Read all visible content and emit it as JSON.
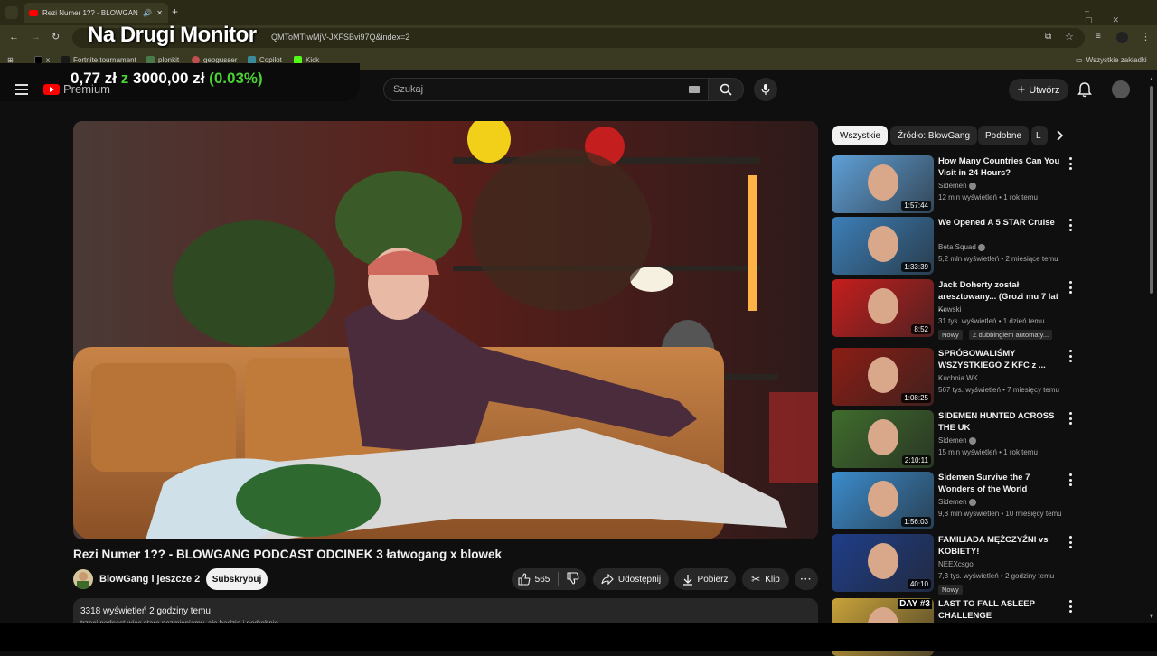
{
  "browser": {
    "tab_title": "Rezi Numer 1?? - BLOWGANG",
    "url": "QMToMTIwMjV-JXFSBvi97Q&index=2",
    "bookmarks": [
      "x",
      "Fortnite tournament",
      "plonkit",
      "geogusser",
      "Copilot",
      "Kick"
    ],
    "bookmarks_right": "Wszystkie zakładki"
  },
  "overlay": {
    "title": "Na Drugi Monitor",
    "donation_current": "0,77 zł",
    "donation_sep": "z",
    "donation_goal": "3000,00 zł",
    "donation_percent": "(0.03%)"
  },
  "header": {
    "logo_text": "Premium",
    "search_placeholder": "Szukaj",
    "create_label": "Utwórz"
  },
  "video": {
    "title": "Rezi Numer 1?? - BLOWGANG PODCAST ODCINEK 3 łatwogang x blowek",
    "channel": "BlowGang i jeszcze 2",
    "subscribe": "Subskrybuj",
    "likes": "565",
    "share": "Udostępnij",
    "download": "Pobierz",
    "clip": "Klip",
    "views_line": "3318 wyświetleń  2 godziny temu",
    "desc_line": "trzeci podcast więc stare pozmieniamy, ale będzie i podrobnie"
  },
  "chips": [
    "Wszystkie",
    "Źródło: BlowGang",
    "Podobne",
    "L"
  ],
  "recommendations": [
    {
      "title": "How Many Countries Can You Visit in 24 Hours?",
      "channel": "Sidemen",
      "verified": true,
      "meta": "12 mln wyświetleń • 1 rok temu",
      "duration": "1:57:44",
      "color": "#5fa0d8"
    },
    {
      "title": "We Opened A 5 STAR Cruise",
      "channel": "Beta Squad",
      "verified": true,
      "meta": "5,2 mln wyświetleń • 2 miesiące temu",
      "duration": "1:33:39",
      "color": "#3c7fb8"
    },
    {
      "title": "Jack Doherty został aresztowany... (Grozi mu 7 lat ...",
      "channel": "Kowski",
      "verified": false,
      "meta": "31 tys. wyświetleń • 1 dzień temu",
      "duration": "8:52",
      "color": "#c61e1e",
      "badge": "Nowy",
      "dub": "Z dubbingiem automaty..."
    },
    {
      "title": "SPRÓBOWALIŚMY WSZYSTKIEGO Z KFC z ...",
      "channel": "Kuchnia WK",
      "verified": false,
      "meta": "567 tys. wyświetleń • 7 miesięcy temu",
      "duration": "1:08:25",
      "color": "#8c1d14"
    },
    {
      "title": "SIDEMEN HUNTED ACROSS THE UK",
      "channel": "Sidemen",
      "verified": true,
      "meta": "15 mln wyświetleń • 1 rok temu",
      "duration": "2:10:11",
      "color": "#3f6c2c"
    },
    {
      "title": "Sidemen Survive the 7 Wonders of the World",
      "channel": "Sidemen",
      "verified": true,
      "meta": "9,8 mln wyświetleń • 10 miesięcy temu",
      "duration": "1:56:03",
      "color": "#3b8ccd"
    },
    {
      "title": "FAMILIADA MĘŻCZYŹNI vs KOBIETY!",
      "channel": "NEEXcsgo",
      "verified": false,
      "meta": "7,3 tys. wyświetleń • 2 godziny temu",
      "duration": "40:10",
      "color": "#1f3e8a",
      "badge": "Nowy"
    },
    {
      "title": "LAST TO FALL ASLEEP CHALLENGE",
      "channel": "",
      "verified": false,
      "meta": "",
      "duration": "",
      "color": "#c9a33a",
      "thumb_label": "DAY #3"
    }
  ]
}
